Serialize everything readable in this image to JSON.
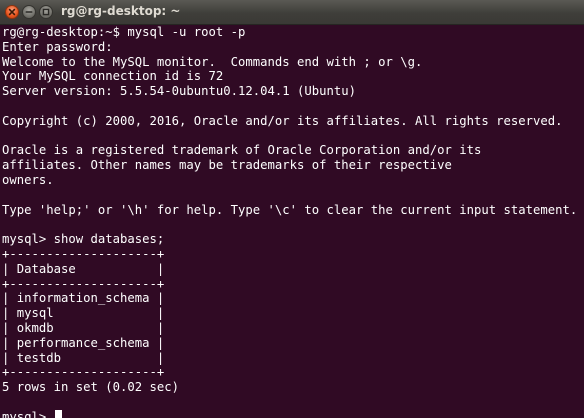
{
  "window": {
    "title": "rg@rg-desktop: ~"
  },
  "terminal": {
    "lines": [
      "rg@rg-desktop:~$ mysql -u root -p",
      "Enter password:",
      "Welcome to the MySQL monitor.  Commands end with ; or \\g.",
      "Your MySQL connection id is 72",
      "Server version: 5.5.54-0ubuntu0.12.04.1 (Ubuntu)",
      "",
      "Copyright (c) 2000, 2016, Oracle and/or its affiliates. All rights reserved.",
      "",
      "Oracle is a registered trademark of Oracle Corporation and/or its",
      "affiliates. Other names may be trademarks of their respective",
      "owners.",
      "",
      "Type 'help;' or '\\h' for help. Type '\\c' to clear the current input statement.",
      "",
      "mysql> show databases;",
      "+--------------------+",
      "| Database           |",
      "+--------------------+",
      "| information_schema |",
      "| mysql              |",
      "| okmdb              |",
      "| performance_schema |",
      "| testdb             |",
      "+--------------------+",
      "5 rows in set (0.02 sec)",
      "",
      "mysql> "
    ],
    "prompt": "mysql> ",
    "current_input": ""
  },
  "colors": {
    "background": "#300a24",
    "foreground": "#ffffff",
    "titlebar": "#3f3e3a",
    "close_button": "#e8541d"
  },
  "icons": {
    "close": "close-icon",
    "minimize": "minimize-icon",
    "maximize": "maximize-icon"
  }
}
